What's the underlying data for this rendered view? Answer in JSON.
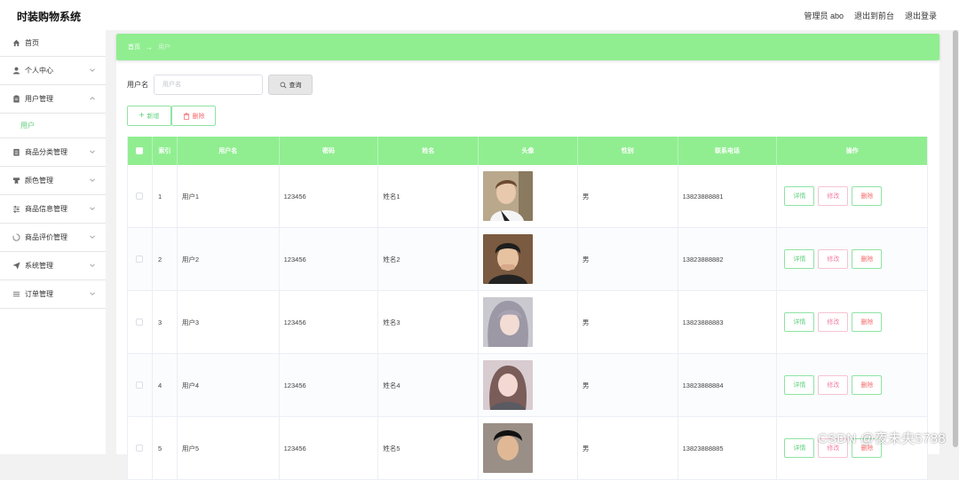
{
  "app": {
    "title": "时装购物系统"
  },
  "header": {
    "user": "管理员 abo",
    "to_front": "退出到前台",
    "logout": "退出登录"
  },
  "sidebar": {
    "items": [
      {
        "label": "首页",
        "icon": "home-icon"
      },
      {
        "label": "个人中心",
        "icon": "user-icon"
      },
      {
        "label": "用户管理",
        "icon": "clipboard-icon"
      },
      {
        "label": "商品分类管理",
        "icon": "document-icon"
      },
      {
        "label": "颜色管理",
        "icon": "bookmark-icon"
      },
      {
        "label": "商品信息管理",
        "icon": "sliders-icon"
      },
      {
        "label": "商品评价管理",
        "icon": "loading-icon"
      },
      {
        "label": "系统管理",
        "icon": "send-icon"
      },
      {
        "label": "订单管理",
        "icon": "list-icon"
      }
    ],
    "sub_users": "用户"
  },
  "breadcrumb": {
    "home": "首页",
    "current": "用户"
  },
  "search": {
    "label": "用户名",
    "placeholder": "用户名",
    "button": "查询"
  },
  "actions": {
    "add": "新增",
    "delete": "删除"
  },
  "table": {
    "headers": [
      "索引",
      "用户名",
      "密码",
      "姓名",
      "头像",
      "性别",
      "联系电话",
      "操作"
    ],
    "rows": [
      {
        "index": "1",
        "username": "用户1",
        "password": "123456",
        "name": "姓名1",
        "sex": "男",
        "phone": "13823888881"
      },
      {
        "index": "2",
        "username": "用户2",
        "password": "123456",
        "name": "姓名2",
        "sex": "男",
        "phone": "13823888882"
      },
      {
        "index": "3",
        "username": "用户3",
        "password": "123456",
        "name": "姓名3",
        "sex": "男",
        "phone": "13823888883"
      },
      {
        "index": "4",
        "username": "用户4",
        "password": "123456",
        "name": "姓名4",
        "sex": "男",
        "phone": "13823888884"
      },
      {
        "index": "5",
        "username": "用户5",
        "password": "123456",
        "name": "姓名5",
        "sex": "男",
        "phone": "13823888885"
      }
    ],
    "ops": {
      "detail": "详情",
      "edit": "修改",
      "remove": "删除"
    }
  },
  "watermark": "CSDN @夜未央5788",
  "colors": {
    "accent": "#90ee90",
    "accent_text": "#5fcf7c",
    "danger": "#f56c6c"
  }
}
